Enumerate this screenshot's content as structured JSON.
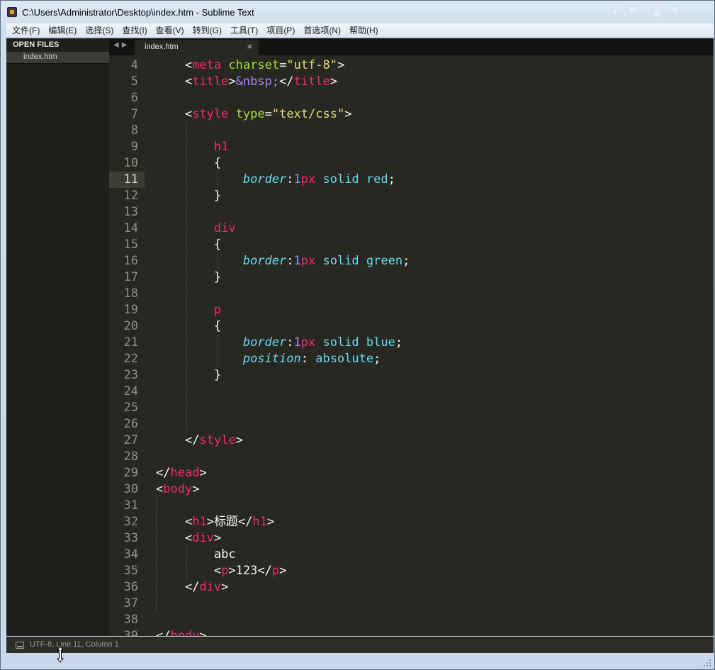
{
  "window": {
    "title": "C:\\Users\\Administrator\\Desktop\\index.htm - Sublime Text"
  },
  "menu": [
    {
      "label": "文件(F)"
    },
    {
      "label": "编辑(E)"
    },
    {
      "label": "选择(S)"
    },
    {
      "label": "查找(I)"
    },
    {
      "label": "查看(V)"
    },
    {
      "label": "转到(G)"
    },
    {
      "label": "工具(T)"
    },
    {
      "label": "项目(P)"
    },
    {
      "label": "首选项(N)"
    },
    {
      "label": "帮助(H)"
    }
  ],
  "sidebar": {
    "header": "OPEN FILES",
    "files": [
      {
        "label": "index.htm"
      }
    ]
  },
  "tabs": [
    {
      "label": "index.htm",
      "close_glyph": "×",
      "active": true
    }
  ],
  "tab_nav": {
    "prev_glyph": "◀",
    "next_glyph": "▶"
  },
  "editor": {
    "current_line": 11,
    "lines": [
      {
        "n": "4",
        "tokens": [
          {
            "t": "    ",
            "c": "text"
          },
          {
            "t": "<",
            "c": "punct"
          },
          {
            "t": "meta",
            "c": "tag"
          },
          {
            "t": " ",
            "c": "text"
          },
          {
            "t": "charset",
            "c": "attr"
          },
          {
            "t": "=",
            "c": "punct"
          },
          {
            "t": "\"utf-8\"",
            "c": "str"
          },
          {
            "t": ">",
            "c": "punct"
          }
        ]
      },
      {
        "n": "5",
        "tokens": [
          {
            "t": "    ",
            "c": "text"
          },
          {
            "t": "<",
            "c": "punct"
          },
          {
            "t": "title",
            "c": "tag"
          },
          {
            "t": ">",
            "c": "punct"
          },
          {
            "t": "&nbsp;",
            "c": "ent"
          },
          {
            "t": "</",
            "c": "punct"
          },
          {
            "t": "title",
            "c": "tag"
          },
          {
            "t": ">",
            "c": "punct"
          }
        ]
      },
      {
        "n": "6",
        "tokens": []
      },
      {
        "n": "7",
        "tokens": [
          {
            "t": "    ",
            "c": "text"
          },
          {
            "t": "<",
            "c": "punct"
          },
          {
            "t": "style",
            "c": "tag"
          },
          {
            "t": " ",
            "c": "text"
          },
          {
            "t": "type",
            "c": "attr"
          },
          {
            "t": "=",
            "c": "punct"
          },
          {
            "t": "\"text/css\"",
            "c": "str"
          },
          {
            "t": ">",
            "c": "punct"
          }
        ]
      },
      {
        "n": "8",
        "tokens": []
      },
      {
        "n": "9",
        "tokens": [
          {
            "t": "        ",
            "c": "text"
          },
          {
            "t": "h1",
            "c": "sel"
          }
        ]
      },
      {
        "n": "10",
        "tokens": [
          {
            "t": "        ",
            "c": "text"
          },
          {
            "t": "{",
            "c": "punct"
          }
        ]
      },
      {
        "n": "11",
        "tokens": [
          {
            "t": "            ",
            "c": "text"
          },
          {
            "t": "border",
            "c": "prop"
          },
          {
            "t": ":",
            "c": "punct"
          },
          {
            "t": "1",
            "c": "num"
          },
          {
            "t": "px",
            "c": "unit"
          },
          {
            "t": " ",
            "c": "text"
          },
          {
            "t": "solid",
            "c": "val"
          },
          {
            "t": " ",
            "c": "text"
          },
          {
            "t": "red",
            "c": "val"
          },
          {
            "t": ";",
            "c": "punct"
          }
        ]
      },
      {
        "n": "12",
        "tokens": [
          {
            "t": "        ",
            "c": "text"
          },
          {
            "t": "}",
            "c": "punct"
          }
        ]
      },
      {
        "n": "13",
        "tokens": []
      },
      {
        "n": "14",
        "tokens": [
          {
            "t": "        ",
            "c": "text"
          },
          {
            "t": "div",
            "c": "sel"
          }
        ]
      },
      {
        "n": "15",
        "tokens": [
          {
            "t": "        ",
            "c": "text"
          },
          {
            "t": "{",
            "c": "punct"
          }
        ]
      },
      {
        "n": "16",
        "tokens": [
          {
            "t": "            ",
            "c": "text"
          },
          {
            "t": "border",
            "c": "prop"
          },
          {
            "t": ":",
            "c": "punct"
          },
          {
            "t": "1",
            "c": "num"
          },
          {
            "t": "px",
            "c": "unit"
          },
          {
            "t": " ",
            "c": "text"
          },
          {
            "t": "solid",
            "c": "val"
          },
          {
            "t": " ",
            "c": "text"
          },
          {
            "t": "green",
            "c": "val"
          },
          {
            "t": ";",
            "c": "punct"
          }
        ]
      },
      {
        "n": "17",
        "tokens": [
          {
            "t": "        ",
            "c": "text"
          },
          {
            "t": "}",
            "c": "punct"
          }
        ]
      },
      {
        "n": "18",
        "tokens": []
      },
      {
        "n": "19",
        "tokens": [
          {
            "t": "        ",
            "c": "text"
          },
          {
            "t": "p",
            "c": "sel"
          }
        ]
      },
      {
        "n": "20",
        "tokens": [
          {
            "t": "        ",
            "c": "text"
          },
          {
            "t": "{",
            "c": "punct"
          }
        ]
      },
      {
        "n": "21",
        "tokens": [
          {
            "t": "            ",
            "c": "text"
          },
          {
            "t": "border",
            "c": "prop"
          },
          {
            "t": ":",
            "c": "punct"
          },
          {
            "t": "1",
            "c": "num"
          },
          {
            "t": "px",
            "c": "unit"
          },
          {
            "t": " ",
            "c": "text"
          },
          {
            "t": "solid",
            "c": "val"
          },
          {
            "t": " ",
            "c": "text"
          },
          {
            "t": "blue",
            "c": "val"
          },
          {
            "t": ";",
            "c": "punct"
          }
        ]
      },
      {
        "n": "22",
        "tokens": [
          {
            "t": "            ",
            "c": "text"
          },
          {
            "t": "position",
            "c": "prop"
          },
          {
            "t": ":",
            "c": "punct"
          },
          {
            "t": " ",
            "c": "text"
          },
          {
            "t": "absolute",
            "c": "val"
          },
          {
            "t": ";",
            "c": "punct"
          }
        ]
      },
      {
        "n": "23",
        "tokens": [
          {
            "t": "        ",
            "c": "text"
          },
          {
            "t": "}",
            "c": "punct"
          }
        ]
      },
      {
        "n": "24",
        "tokens": []
      },
      {
        "n": "25",
        "tokens": []
      },
      {
        "n": "26",
        "tokens": []
      },
      {
        "n": "27",
        "tokens": [
          {
            "t": "    ",
            "c": "text"
          },
          {
            "t": "</",
            "c": "punct"
          },
          {
            "t": "style",
            "c": "tag"
          },
          {
            "t": ">",
            "c": "punct"
          }
        ]
      },
      {
        "n": "28",
        "tokens": []
      },
      {
        "n": "29",
        "tokens": [
          {
            "t": "</",
            "c": "punct"
          },
          {
            "t": "head",
            "c": "tag"
          },
          {
            "t": ">",
            "c": "punct"
          }
        ]
      },
      {
        "n": "30",
        "tokens": [
          {
            "t": "<",
            "c": "punct"
          },
          {
            "t": "body",
            "c": "tag"
          },
          {
            "t": ">",
            "c": "punct"
          }
        ]
      },
      {
        "n": "31",
        "tokens": []
      },
      {
        "n": "32",
        "tokens": [
          {
            "t": "    ",
            "c": "text"
          },
          {
            "t": "<",
            "c": "punct"
          },
          {
            "t": "h1",
            "c": "tag"
          },
          {
            "t": ">",
            "c": "punct"
          },
          {
            "t": "标题",
            "c": "text"
          },
          {
            "t": "</",
            "c": "punct"
          },
          {
            "t": "h1",
            "c": "tag"
          },
          {
            "t": ">",
            "c": "punct"
          }
        ]
      },
      {
        "n": "33",
        "tokens": [
          {
            "t": "    ",
            "c": "text"
          },
          {
            "t": "<",
            "c": "punct"
          },
          {
            "t": "div",
            "c": "tag"
          },
          {
            "t": ">",
            "c": "punct"
          }
        ]
      },
      {
        "n": "34",
        "tokens": [
          {
            "t": "        ",
            "c": "text"
          },
          {
            "t": "abc",
            "c": "text"
          }
        ]
      },
      {
        "n": "35",
        "tokens": [
          {
            "t": "        ",
            "c": "text"
          },
          {
            "t": "<",
            "c": "punct"
          },
          {
            "t": "p",
            "c": "tag"
          },
          {
            "t": ">",
            "c": "punct"
          },
          {
            "t": "123",
            "c": "text"
          },
          {
            "t": "</",
            "c": "punct"
          },
          {
            "t": "p",
            "c": "tag"
          },
          {
            "t": ">",
            "c": "punct"
          }
        ]
      },
      {
        "n": "36",
        "tokens": [
          {
            "t": "    ",
            "c": "text"
          },
          {
            "t": "</",
            "c": "punct"
          },
          {
            "t": "div",
            "c": "tag"
          },
          {
            "t": ">",
            "c": "punct"
          }
        ]
      },
      {
        "n": "37",
        "tokens": []
      },
      {
        "n": "38",
        "tokens": []
      },
      {
        "n": "39",
        "tokens": [
          {
            "t": "</",
            "c": "punct"
          },
          {
            "t": "body",
            "c": "tag"
          },
          {
            "t": ">",
            "c": "punct"
          }
        ]
      }
    ]
  },
  "status": {
    "text": "UTF-8, Line 11, Column 1"
  },
  "colors": {
    "editor_bg": "#272822",
    "sidebar_bg": "#1f201b",
    "tag": "#f92672",
    "attr": "#a6e22e",
    "string": "#e6db74",
    "number": "#ae81ff",
    "property": "#66d9ef",
    "text": "#f8f8f2"
  }
}
